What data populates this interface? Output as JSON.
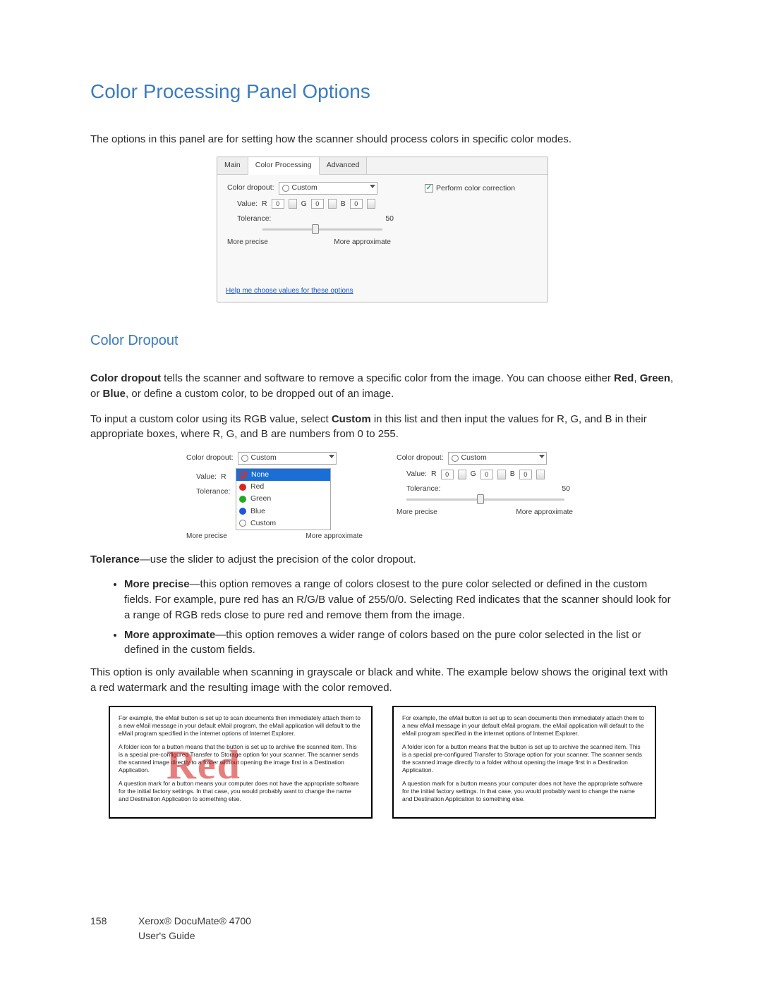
{
  "h1": "Color Processing Panel Options",
  "intro": "The options in this panel are for setting how the scanner should process colors in specific color modes.",
  "panel": {
    "tabs": {
      "main": "Main",
      "color": "Color Processing",
      "advanced": "Advanced"
    },
    "labels": {
      "dropout": "Color dropout:",
      "value": "Value:",
      "tolerance": "Tolerance:",
      "r": "R",
      "g": "G",
      "b": "B",
      "zero": "0",
      "tolval": "50",
      "precise": "More precise",
      "approx": "More approximate"
    },
    "custom": "Custom",
    "perform": "Perform color correction",
    "help": "Help me choose values for these options"
  },
  "h2": "Color Dropout",
  "p1a": "Color dropout",
  "p1b": " tells the scanner and software to remove a specific color from the image. You can choose either ",
  "p1c": "Red",
  "p1d": ", ",
  "p1e": "Green",
  "p1f": ", or ",
  "p1g": "Blue",
  "p1h": ", or define a custom color, to be dropped out of an image.",
  "p2a": "To input a custom color using its RGB value, select ",
  "p2b": "Custom",
  "p2c": " in this list and then input the values for R, G, and B in their appropriate boxes, where R, G, and B are numbers from 0 to 255.",
  "dropdown": {
    "none": "None",
    "red": "Red",
    "green": "Green",
    "blue": "Blue",
    "custom": "Custom"
  },
  "tolline_a": "Tolerance",
  "tolline_b": "—use the slider to adjust the precision of the color dropout.",
  "bullets": {
    "b1a": "More precise",
    "b1b": "—this option removes a range of colors closest to the pure color selected or defined in the custom fields. For example, pure red has an R/G/B value of 255/0/0. Selecting Red indicates that the scanner should look for a range of RGB reds close to pure red and remove them from the image.",
    "b2a": "More approximate",
    "b2b": "—this option removes a wider range of colors based on the pure color selected in the list or defined in the custom fields."
  },
  "p3": "This option is only available when scanning in grayscale or black and white. The example below shows the original text with a red watermark and the resulting image with the color removed.",
  "doc": {
    "p1": "For example, the eMail button is set up to scan documents then immediately attach them to a new eMail message in your default eMail program, the eMail application will default to the eMail program specified in the internet options of Internet Explorer.",
    "p2": "A folder icon for a button means that the button is set up to archive the scanned item. This is a special pre-configured Transfer to Storage option for your scanner. The scanner sends the scanned image directly to a folder without opening the image first in a Destination Application.",
    "p3": "A question mark for a button means your computer does not have the appropriate software for the initial factory settings. In that case, you would probably want to change the name and Destination Application to something else.",
    "wm": "Red"
  },
  "footer": {
    "page": "158",
    "line1": "Xerox® DocuMate® 4700",
    "line2": "User's Guide"
  }
}
